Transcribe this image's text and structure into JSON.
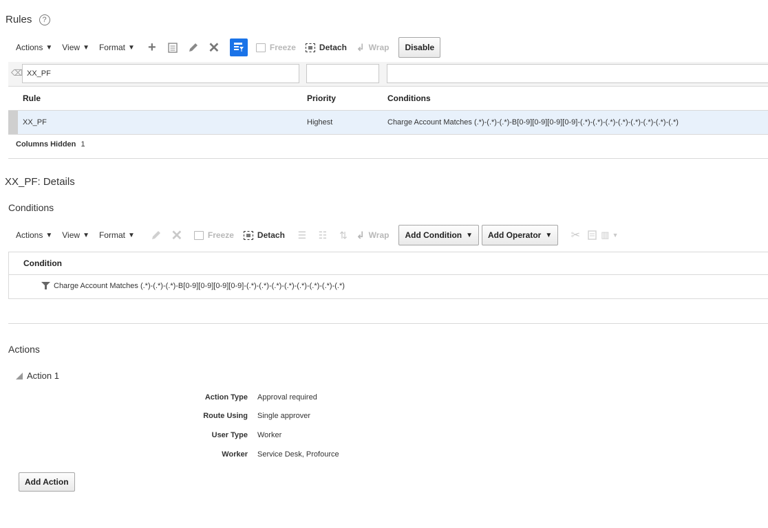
{
  "rules": {
    "title": "Rules",
    "help_icon": "help-circle-icon",
    "toolbar": {
      "actions_label": "Actions",
      "view_label": "View",
      "format_label": "Format",
      "freeze_label": "Freeze",
      "detach_label": "Detach",
      "wrap_label": "Wrap",
      "disable_label": "Disable"
    },
    "filter": {
      "rule_value": "XX_PF",
      "priority_value": "",
      "conditions_value": ""
    },
    "columns": {
      "rule": "Rule",
      "priority": "Priority",
      "conditions": "Conditions"
    },
    "rows": [
      {
        "rule": "XX_PF",
        "priority": "Highest",
        "conditions": "Charge Account Matches (.*)-(.*)-(.*)-B[0-9][0-9][0-9][0-9]-(.*)-(.*)-(.*)-(.*)-(.*)-(.*)-(.*)-(.*)"
      }
    ],
    "columns_hidden_label": "Columns Hidden",
    "columns_hidden_count": "1"
  },
  "details": {
    "title": "XX_PF: Details",
    "conditions": {
      "title": "Conditions",
      "toolbar": {
        "actions_label": "Actions",
        "view_label": "View",
        "format_label": "Format",
        "freeze_label": "Freeze",
        "detach_label": "Detach",
        "wrap_label": "Wrap",
        "add_condition_label": "Add Condition",
        "add_operator_label": "Add Operator"
      },
      "column": "Condition",
      "rows": [
        {
          "text": "Charge Account Matches (.*)-(.*)-(.*)-B[0-9][0-9][0-9][0-9]-(.*)-(.*)-(.*)-(.*)-(.*)-(.*)-(.*)-(.*)"
        }
      ]
    },
    "actions": {
      "title": "Actions",
      "action_name": "Action 1",
      "fields": [
        {
          "label": "Action Type",
          "value": "Approval required"
        },
        {
          "label": "Route Using",
          "value": "Single approver"
        },
        {
          "label": "User Type",
          "value": "Worker"
        },
        {
          "label": "Worker",
          "value": "Service Desk, Profource"
        }
      ],
      "add_action_label": "Add Action"
    }
  },
  "colors": {
    "selected_row": "#e8f1fb",
    "selected_marker": "#cfcfcf",
    "accent": "#1a73e8"
  }
}
